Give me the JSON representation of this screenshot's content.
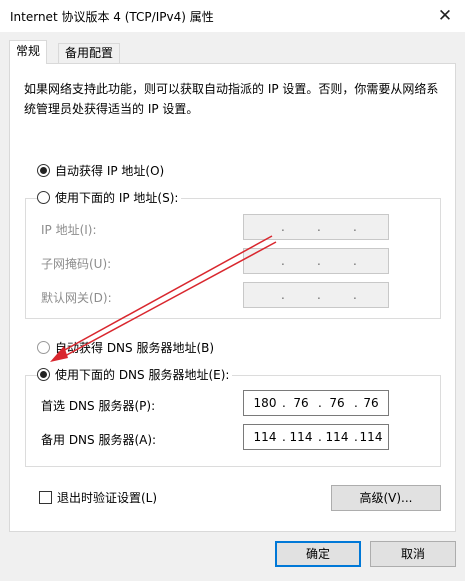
{
  "window": {
    "title": "Internet 协议版本 4 (TCP/IPv4) 属性",
    "close_glyph": "✕"
  },
  "tabs": [
    {
      "label": "常规",
      "active": true
    },
    {
      "label": "备用配置",
      "active": false
    }
  ],
  "description": "如果网络支持此功能，则可以获取自动指派的 IP 设置。否则，你需要从网络系统管理员处获得适当的 IP 设置。",
  "ip_section": {
    "auto_label": "自动获得 IP 地址(O)",
    "auto_checked": true,
    "manual_label": "使用下面的 IP 地址(S):",
    "manual_checked": false,
    "fields": [
      {
        "label": "IP 地址(I):",
        "value": [
          "",
          "",
          "",
          ""
        ]
      },
      {
        "label": "子网掩码(U):",
        "value": [
          "",
          "",
          "",
          ""
        ]
      },
      {
        "label": "默认网关(D):",
        "value": [
          "",
          "",
          "",
          ""
        ]
      }
    ]
  },
  "dns_section": {
    "auto_label": "自动获得 DNS 服务器地址(B)",
    "auto_checked": false,
    "manual_label": "使用下面的 DNS 服务器地址(E):",
    "manual_checked": true,
    "fields": [
      {
        "label": "首选 DNS 服务器(P):",
        "value": [
          "180",
          "76",
          "76",
          "76"
        ]
      },
      {
        "label": "备用 DNS 服务器(A):",
        "value": [
          "114",
          "114",
          "114",
          "114"
        ]
      }
    ]
  },
  "validate_on_exit": {
    "label": "退出时验证设置(L)",
    "checked": false
  },
  "advanced_button": "高级(V)...",
  "ok_button": "确定",
  "cancel_button": "取消",
  "colors": {
    "annotation_arrow": "#d9272e",
    "default_button_border": "#0078d7"
  }
}
